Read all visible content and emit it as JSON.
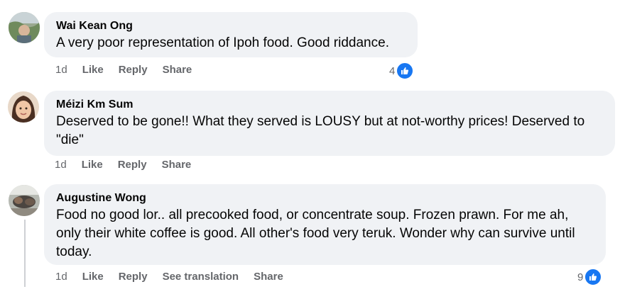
{
  "comments": [
    {
      "author": "Wai Kean Ong",
      "text": "A very poor representation of Ipoh food. Good riddance.",
      "time": "1d",
      "like_label": "Like",
      "reply_label": "Reply",
      "share_label": "Share",
      "reaction_count": "4"
    },
    {
      "author": "Méizi Km Sum",
      "text_line1": "Deserved to be gone!! What they served is LOUSY but at not-worthy prices! Deserved to",
      "text_line2": "\"die\"",
      "time": "1d",
      "like_label": "Like",
      "reply_label": "Reply",
      "share_label": "Share"
    },
    {
      "author": "Augustine Wong",
      "text_line1": "Food no good lor.. all precooked food, or concentrate soup. Frozen prawn. For me ah,",
      "text_line2": "only their white coffee is good. All other's food very teruk. Wonder why can survive until",
      "text_line3": "today.",
      "time": "1d",
      "like_label": "Like",
      "reply_label": "Reply",
      "translate_label": "See translation",
      "share_label": "Share",
      "reaction_count": "9"
    }
  ],
  "colors": {
    "bubble": "#f0f2f5",
    "secondary_text": "#65676b",
    "like_blue": "#1877f2"
  }
}
